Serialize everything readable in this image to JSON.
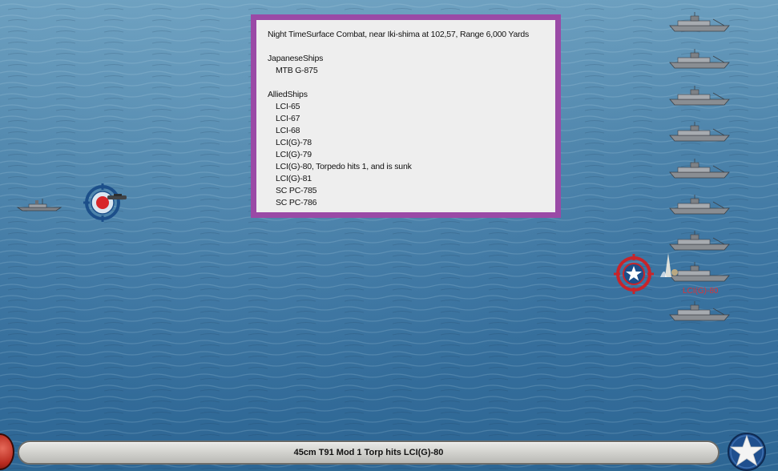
{
  "combat_report": {
    "header": "Night TimeSurface Combat, near Iki-shima at 102,57, Range 6,000 Yards",
    "japanese_heading": "JapaneseShips",
    "japanese_ships": [
      "MTB G-875"
    ],
    "allied_heading": "AlliedShips",
    "allied_ships": [
      "LCI-65",
      "LCI-67",
      "LCI-68",
      "LCI(G)-78",
      "LCI(G)-79",
      "LCI(G)-80, Torpedo hits 1, and is sunk",
      "LCI(G)-81",
      "SC PC-785",
      "SC PC-786"
    ]
  },
  "target_ship_label": "LCI(G)-80",
  "status_bar": {
    "message": "45cm T91 Mod 1 Torp hits LCI(G)-80"
  },
  "colors": {
    "report_border": "#9a4aa6",
    "report_background": "#eeeeee",
    "target_label": "#d8343a",
    "reticle_red": "#c8242a"
  },
  "icons": {
    "japanese_reticle": "japanese-target-reticle-icon",
    "allied_reticle": "allied-star-reticle-icon",
    "allied_roundel": "allied-star-roundel-icon"
  }
}
